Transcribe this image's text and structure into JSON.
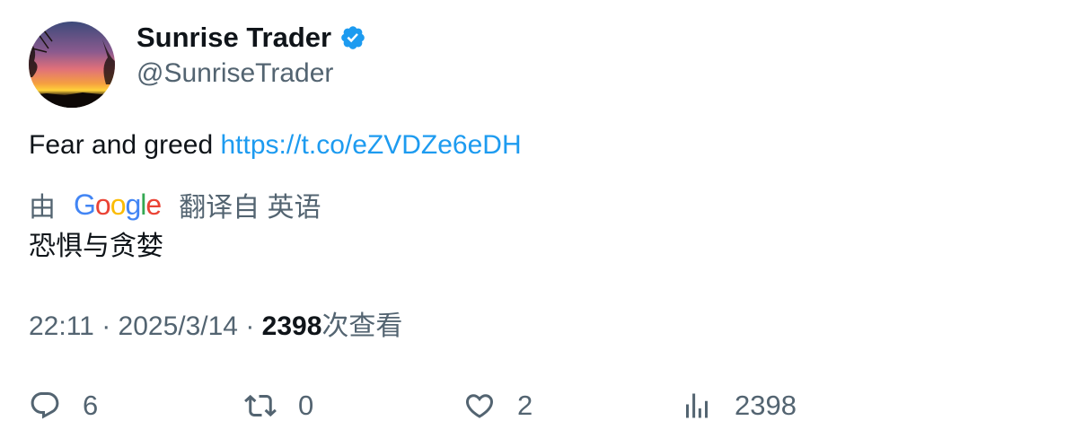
{
  "author": {
    "display_name": "Sunrise Trader",
    "handle": "@SunriseTrader",
    "verified": true,
    "verified_color": "#1d9bf0"
  },
  "tweet": {
    "text": "Fear and greed ",
    "link": "https://t.co/eZVDZe6eDH",
    "link_color": "#1d9bf0"
  },
  "translation": {
    "prefix": "由",
    "provider_logo_text": [
      "G",
      "o",
      "o",
      "g",
      "l",
      "e"
    ],
    "suffix": "翻译自 英语",
    "translated_text": "恐惧与贪婪"
  },
  "meta": {
    "time": "22:11",
    "separator": " · ",
    "date": "2025/3/14",
    "views_count": "2398",
    "views_label": "次查看"
  },
  "actions": {
    "reply_count": "6",
    "retweet_count": "0",
    "like_count": "2",
    "views_count": "2398"
  },
  "icons": {
    "reply": "reply-icon",
    "retweet": "retweet-icon",
    "like": "heart-icon",
    "views": "analytics-icon",
    "verified": "verified-badge-icon"
  }
}
